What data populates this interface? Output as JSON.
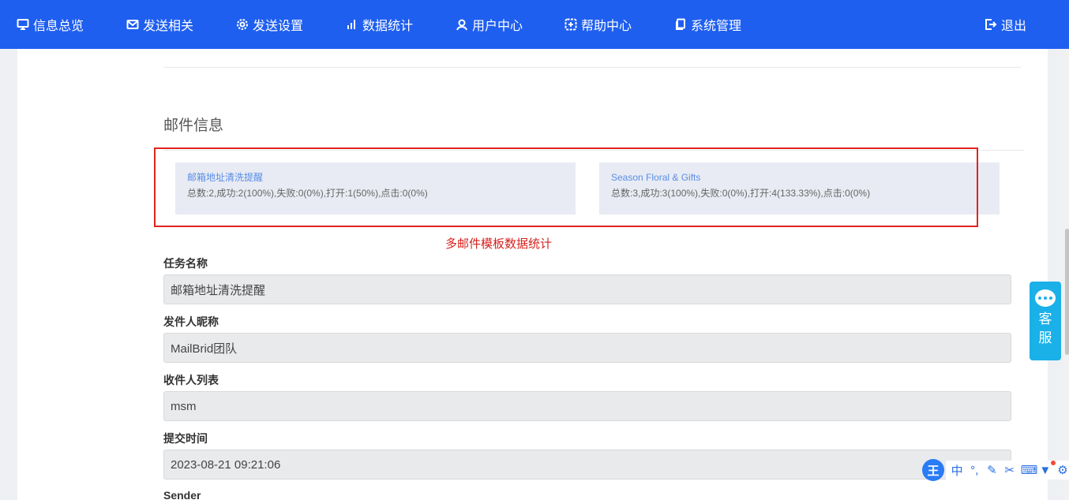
{
  "nav": {
    "items": [
      {
        "label": "信息总览",
        "icon": "monitor-icon"
      },
      {
        "label": "发送相关",
        "icon": "mail-icon"
      },
      {
        "label": "发送设置",
        "icon": "gear-icon"
      },
      {
        "label": "数据统计",
        "icon": "bar-chart-icon"
      },
      {
        "label": "用户中心",
        "icon": "user-icon"
      },
      {
        "label": "帮助中心",
        "icon": "help-icon"
      },
      {
        "label": "系统管理",
        "icon": "copy-icon"
      }
    ],
    "logout": {
      "label": "退出",
      "icon": "logout-icon"
    },
    "background": "#1f5ff0"
  },
  "section": {
    "title": "邮件信息"
  },
  "stats": [
    {
      "name": "邮箱地址清洗提醒",
      "summary": "总数:2,成功:2(100%),失败:0(0%),打开:1(50%),点击:0(0%)"
    },
    {
      "name": "Season Floral & Gifts",
      "summary": "总数:3,成功:3(100%),失败:0(0%),打开:4(133.33%),点击:0(0%)"
    }
  ],
  "annotation": "多邮件模板数据统计",
  "fields": {
    "task_name": {
      "label": "任务名称",
      "value": "邮箱地址清洗提醒"
    },
    "sender_nickname": {
      "label": "发件人昵称",
      "value": "MailBrid团队"
    },
    "recipient_list": {
      "label": "收件人列表",
      "value": "msm"
    },
    "submit_time": {
      "label": "提交时间",
      "value": "2023-08-21 09:21:06"
    },
    "sender": {
      "label": "Sender"
    }
  },
  "customer_service": {
    "label_1": "客",
    "label_2": "服",
    "icon": "chat-icon"
  },
  "ime": {
    "logo": "王",
    "mode": "中",
    "icons": [
      "punctuation-icon",
      "pen-icon",
      "scissors-icon",
      "keyboard-icon",
      "shirt-icon",
      "gear-icon"
    ]
  }
}
